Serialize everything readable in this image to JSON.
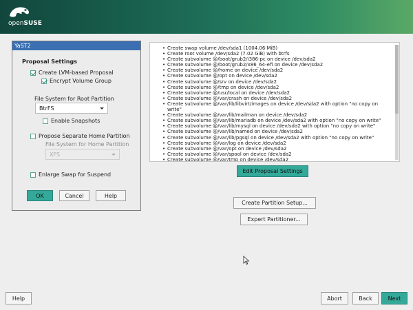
{
  "header": {
    "brand_prefix": "open",
    "brand_name": "SUSE"
  },
  "dialog": {
    "title": "YaST2",
    "section_title": "Proposal Settings",
    "create_lvm_label": "Create LVM-based Proposal",
    "encrypt_label": "Encrypt Volume Group",
    "root_fs_label": "File System for Root Partition",
    "root_fs_value": "BtrFS",
    "snapshots_label": "Enable Snapshots",
    "separate_home_label": "Propose Separate Home Partition",
    "home_fs_label": "File System for Home Partition",
    "home_fs_value": "XFS",
    "enlarge_swap_label": "Enlarge Swap for Suspend",
    "ok_label": "OK",
    "cancel_label": "Cancel",
    "help_label": "Help"
  },
  "proposal": {
    "items": [
      "Create swap volume /dev/sda1 (1004.06 MiB)",
      "Create root volume /dev/sda2 (7.02 GiB) with btrfs",
      "Create subvolume @/boot/grub2/i386-pc on device /dev/sda2",
      "Create subvolume @/boot/grub2/x86_64-efi on device /dev/sda2",
      "Create subvolume @/home on device /dev/sda2",
      "Create subvolume @/opt on device /dev/sda2",
      "Create subvolume @/srv on device /dev/sda2",
      "Create subvolume @/tmp on device /dev/sda2",
      "Create subvolume @/usr/local on device /dev/sda2",
      "Create subvolume @/var/crash on device /dev/sda2",
      "Create subvolume @/var/lib/libvirt/images on device /dev/sda2 with option \"no copy on write\"",
      "Create subvolume @/var/lib/mailman on device /dev/sda2",
      "Create subvolume @/var/lib/mariadb on device /dev/sda2 with option \"no copy on write\"",
      "Create subvolume @/var/lib/mysql on device /dev/sda2 with option \"no copy on write\"",
      "Create subvolume @/var/lib/named on device /dev/sda2",
      "Create subvolume @/var/lib/pgsql on device /dev/sda2 with option \"no copy on write\"",
      "Create subvolume @/var/log on device /dev/sda2",
      "Create subvolume @/var/opt on device /dev/sda2",
      "Create subvolume @/var/spool on device /dev/sda2",
      "Create subvolume @/var/tmp on device /dev/sda2"
    ]
  },
  "actions": {
    "edit_proposal": "Edit Proposal Settings",
    "create_partition_setup": "Create Partition Setup...",
    "expert_partitioner": "Expert Partitioner..."
  },
  "footer": {
    "help_label": "Help",
    "abort_label": "Abort",
    "back_label": "Back",
    "next_label": "Next"
  },
  "icons": {
    "logo": "chameleon-logo-icon",
    "cursor": "mouse-cursor-icon"
  }
}
